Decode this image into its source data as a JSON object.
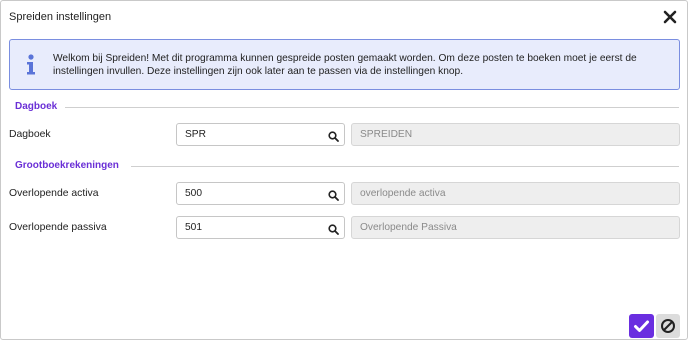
{
  "dialog": {
    "title": "Spreiden instellingen",
    "info_text": "Welkom bij Spreiden! Met dit programma kunnen gespreide posten gemaakt worden. Om deze posten te boeken moet je eerst de instellingen invullen. Deze instellingen zijn ook later aan te passen via de instellingen knop."
  },
  "sections": {
    "dagboek": "Dagboek",
    "grootboek": "Grootboekrekeningen"
  },
  "fields": {
    "dagboek": {
      "label": "Dagboek",
      "value": "SPR",
      "description": "SPREIDEN"
    },
    "overlopende_activa": {
      "label": "Overlopende activa",
      "value": "500",
      "description": "overlopende activa"
    },
    "overlopende_passiva": {
      "label": "Overlopende passiva",
      "value": "501",
      "description": "Overlopende Passiva"
    }
  },
  "colors": {
    "accent": "#6a2ee0",
    "info_background": "#e8ecfc",
    "info_border": "#7a8ee0"
  },
  "icons": {
    "close": "close-icon",
    "info": "info-icon",
    "search": "search-icon",
    "confirm": "checkmark-icon",
    "cancel": "cancel-icon"
  }
}
